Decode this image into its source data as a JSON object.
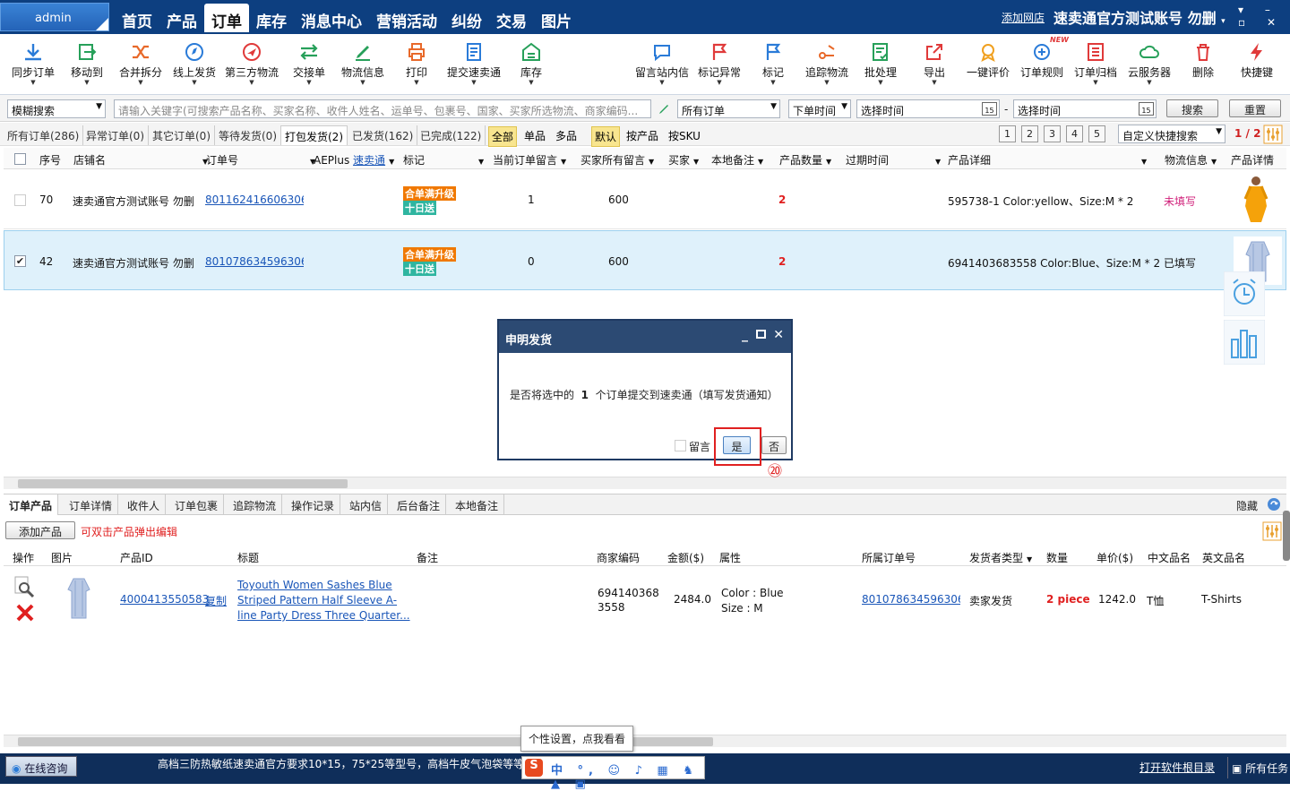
{
  "window": {
    "user": "admin",
    "add_shop": "添加网店",
    "account": "速卖通官方测试账号 勿删",
    "controls": "▾ – ▫ ✕"
  },
  "nav": [
    "首页",
    "产品",
    "订单",
    "库存",
    "消息中心",
    "营销活动",
    "纠纷",
    "交易",
    "图片"
  ],
  "nav_active": "订单",
  "toolbar_left": [
    "同步订单",
    "移动到",
    "合并拆分",
    "线上发货",
    "第三方物流",
    "交接单",
    "物流信息",
    "打印",
    "提交速卖通",
    "库存"
  ],
  "toolbar_right": [
    "留言站内信",
    "标记异常",
    "标记",
    "追踪物流",
    "批处理",
    "导出",
    "一键评价",
    "订单规则",
    "订单归档",
    "云服务器",
    "删除",
    "快捷键"
  ],
  "new_badge": "NEW",
  "search": {
    "mode": "模糊搜索",
    "placeholder": "请输入关键字(可搜索产品名称、买家名称、收件人姓名、运单号、包裹号、国家、买家所选物流、商家编码...",
    "scope": "所有订单",
    "time_type": "下单时间",
    "start_placeholder": "选择时间",
    "dash": "-",
    "end_placeholder": "选择时间",
    "calendar_day": "15",
    "search_btn": "搜索",
    "reset_btn": "重置"
  },
  "order_tabs": [
    "所有订单(286)",
    "异常订单(0)",
    "其它订单(0)",
    "等待发货(0)",
    "打包发货(2)",
    "已发货(162)",
    "已完成(122)"
  ],
  "order_tab_active": "打包发货(2)",
  "filters": [
    "全部",
    "单品",
    "多品",
    "默认",
    "按产品",
    "按SKU"
  ],
  "pages": [
    "1",
    "2",
    "3",
    "4",
    "5"
  ],
  "custom_search": "自定义快捷搜索",
  "page_indicator": "1 / 2",
  "columns": [
    "序号",
    "店铺名",
    "订单号",
    "AEPlus",
    "速卖通",
    "标记",
    "当前订单留言",
    "买家所有留言",
    "买家",
    "本地备注",
    "产品数量",
    "过期时间",
    "产品详细",
    "物流信息",
    "产品详情"
  ],
  "rows": [
    {
      "seq": "70",
      "shop": "速卖通官方测试账号 勿删",
      "order": "801162416606306",
      "tag1": "合单满升级",
      "tag2": "十日送",
      "cur_msg": "1",
      "all_msg": "600",
      "qty": "2",
      "detail": "595738-1  Color:yellow、Size:M * 2",
      "logistics": "未填写",
      "checked": false
    },
    {
      "seq": "42",
      "shop": "速卖通官方测试账号 勿删",
      "order": "801078634596306",
      "tag1": "合单满升级",
      "tag2": "十日送",
      "cur_msg": "0",
      "all_msg": "600",
      "qty": "2",
      "detail": "6941403683558  Color:Blue、Size:M * 2",
      "logistics": "已填写",
      "checked": true
    }
  ],
  "dialog": {
    "title": "申明发货",
    "msg_pre": "是否将选中的",
    "count": "1",
    "msg_post": "个订单提交到速卖通（填写发货通知）",
    "leave_msg": "留言",
    "yes": "是",
    "no": "否"
  },
  "step_number": "⑳",
  "bottom_tabs": [
    "订单产品",
    "订单详情",
    "收件人",
    "订单包裹",
    "追踪物流",
    "操作记录",
    "站内信",
    "后台备注",
    "本地备注"
  ],
  "hide_label": "隐藏",
  "add_product": "添加产品",
  "edit_hint": "可双击产品弹出编辑",
  "prod_columns": [
    "操作",
    "图片",
    "产品ID",
    "标题",
    "备注",
    "商家编码",
    "金额($)",
    "属性",
    "所属订单号",
    "发货者类型",
    "数量",
    "单价($)",
    "中文品名",
    "英文品名"
  ],
  "product": {
    "id": "4000413550583",
    "copy": "复制",
    "title_lines": [
      "Toyouth Women Sashes Blue",
      "Striped Pattern Half Sleeve A-",
      "line Party Dress Three Quarter..."
    ],
    "sku_lines": [
      "694140368",
      "3558"
    ],
    "amount": "2484.0",
    "attr_lines": [
      "Color : Blue",
      "Size : M"
    ],
    "order": "801078634596306",
    "shipper": "卖家发货",
    "qty": "2 piece",
    "unit_price": "1242.0",
    "cn_name": "T恤",
    "en_name": "T-Shirts"
  },
  "tooltip": "个性设置，点我看看",
  "status": {
    "consult": "在线咨询",
    "marquee": "高档三防热敏纸速卖通官方要求10*15，75*25等型号，高档牛皮气泡袋等等耗",
    "open_dir": "打开软件根目录",
    "tasks": "所有任务"
  },
  "colors": {
    "nav_bg": "#0d3f80",
    "accent_red": "#e02020",
    "tag_orange": "#f07800",
    "tag_green": "#2fb5a0",
    "link": "#1a56b8"
  }
}
